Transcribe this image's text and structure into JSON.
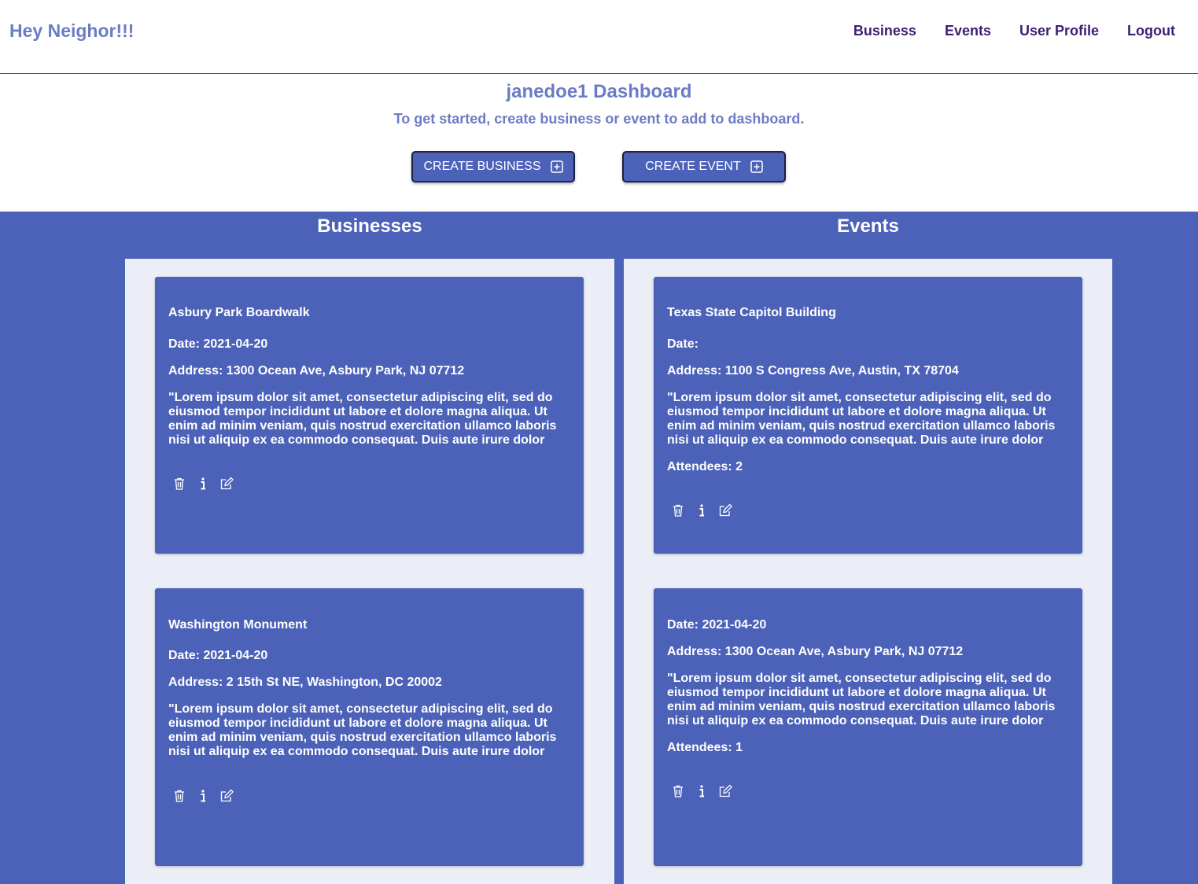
{
  "nav": {
    "brand": "Hey Neighor!!!",
    "links": [
      "Business",
      "Events",
      "User Profile",
      "Logout"
    ]
  },
  "dashboard": {
    "title": "janedoe1 Dashboard",
    "subtitle": "To get started, create business or event to add to dashboard.",
    "create_business_label": "CREATE BUSINESS",
    "create_event_label": "CREATE EVENT"
  },
  "businesses": {
    "heading": "Businesses",
    "items": [
      {
        "name": "Asbury Park Boardwalk",
        "date": "Date: 2021-04-20",
        "address": "Address: 1300 Ocean Ave, Asbury Park, NJ 07712",
        "desc_lines": [
          "\"Lorem ipsum dolor sit amet, consectetur adipiscing elit, sed do",
          "eiusmod tempor incididunt ut labore et dolore magna aliqua. Ut",
          "enim ad minim veniam, quis nostrud exercitation ullamco laboris",
          "nisi ut aliquip ex ea commodo consequat. Duis aute irure dolor"
        ]
      },
      {
        "name": "Washington Monument",
        "date": "Date: 2021-04-20",
        "address": "Address: 2 15th St NE, Washington, DC 20002",
        "desc_lines": [
          "\"Lorem ipsum dolor sit amet, consectetur adipiscing elit, sed do",
          "eiusmod tempor incididunt ut labore et dolore magna aliqua. Ut",
          "enim ad minim veniam, quis nostrud exercitation ullamco laboris",
          "nisi ut aliquip ex ea commodo consequat. Duis aute irure dolor"
        ]
      }
    ]
  },
  "events": {
    "heading": "Events",
    "items": [
      {
        "name": "Texas State Capitol Building",
        "date": "Date:",
        "address": "Address: 1100 S Congress Ave, Austin, TX 78704",
        "desc_lines": [
          "\"Lorem ipsum dolor sit amet, consectetur adipiscing elit, sed do",
          "eiusmod tempor incididunt ut labore et dolore magna aliqua. Ut",
          "enim ad minim veniam, quis nostrud exercitation ullamco laboris",
          "nisi ut aliquip ex ea commodo consequat. Duis aute irure dolor"
        ],
        "attendees": "Attendees: 2"
      },
      {
        "name": "",
        "date": "Date: 2021-04-20",
        "address": "Address: 1300 Ocean Ave, Asbury Park, NJ 07712",
        "desc_lines": [
          "\"Lorem ipsum dolor sit amet, consectetur adipiscing elit, sed do",
          "eiusmod tempor incididunt ut labore et dolore magna aliqua. Ut",
          "enim ad minim veniam, quis nostrud exercitation ullamco laboris",
          "nisi ut aliquip ex ea commodo consequat. Duis aute irure dolor"
        ],
        "attendees": "Attendees: 1"
      }
    ]
  },
  "icons": {
    "delete": "trash-icon",
    "info": "info-icon",
    "edit": "edit-icon",
    "add": "plus-square-icon"
  },
  "colors": {
    "brand": "#6b7cc4",
    "nav_link": "#3d1e73",
    "primary": "#4c62b9",
    "panel": "#eceef7"
  }
}
